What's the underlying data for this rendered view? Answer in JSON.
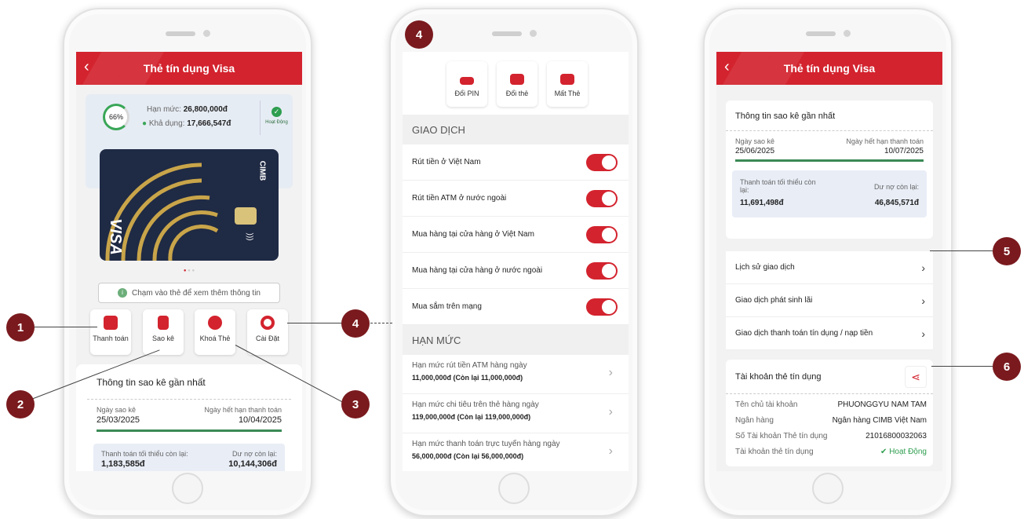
{
  "screen1": {
    "title": "Thẻ tín dụng Visa",
    "progress_pct": "66%",
    "progress_value": 0.66,
    "limit_label": "Hạn mức:",
    "limit_value": "26,800,000đ",
    "available_label": "Khả dụng:",
    "available_value": "17,666,547đ",
    "status": "Hoạt Động",
    "card_brand": "VISA",
    "card_bank": "CIMB",
    "hint": "Chạm vào thẻ để xem thêm thông tin",
    "actions": [
      {
        "label": "Thanh toán",
        "icon": "wallet-icon"
      },
      {
        "label": "Sao kê",
        "icon": "statement-icon"
      },
      {
        "label": "Khoá Thẻ",
        "icon": "lock-icon"
      },
      {
        "label": "Cài Đặt",
        "icon": "gear-icon"
      }
    ],
    "statement": {
      "heading": "Thông tin sao kê gần nhất",
      "date_label": "Ngày sao kê",
      "date_value": "25/03/2025",
      "due_label": "Ngày hết hạn thanh toán",
      "due_value": "10/04/2025",
      "min_label": "Thanh toán tối thiểu còn lại:",
      "min_value": "1,183,585đ",
      "debt_label": "Dư nợ còn lại:",
      "debt_value": "10,144,306đ"
    }
  },
  "screen2": {
    "actions": [
      {
        "label": "Đổi PIN",
        "icon": "pin-icon"
      },
      {
        "label": "Đổi thẻ",
        "icon": "card-change-icon"
      },
      {
        "label": "Mất Thẻ",
        "icon": "lost-card-icon"
      }
    ],
    "transactions_heading": "GIAO DỊCH",
    "transactions": [
      "Rút tiền ở Việt Nam",
      "Rút tiền ATM ở nước ngoài",
      "Mua hàng tại cửa hàng ở Việt Nam",
      "Mua hàng tại cửa hàng ở nước ngoài",
      "Mua sắm trên mạng"
    ],
    "limits_heading": "HẠN MỨC",
    "limits": [
      {
        "label": "Hạn mức rút tiền ATM hàng ngày",
        "value": "11,000,000đ (Còn lại 11,000,000đ)"
      },
      {
        "label": "Hạn mức chi tiêu trên thẻ hàng ngày",
        "value": "119,000,000đ (Còn lại 119,000,000đ)"
      },
      {
        "label": "Hạn mức thanh toán trực tuyến hàng ngày",
        "value": "56,000,000đ (Còn lại 56,000,000đ)"
      }
    ]
  },
  "screen3": {
    "title": "Thẻ tín dụng Visa",
    "statement": {
      "heading": "Thông tin sao kê gần nhất",
      "date_label": "Ngày sao kê",
      "date_value": "25/06/2025",
      "due_label": "Ngày hết hạn thanh toán",
      "due_value": "10/07/2025",
      "min_label": "Thanh toán tối thiểu còn lại:",
      "min_value": "11,691,498đ",
      "debt_label": "Dư nợ còn lại:",
      "debt_value": "46,845,571đ"
    },
    "menu": [
      "Lịch sử giao dịch",
      "Giao dịch phát sinh lãi",
      "Giao dịch thanh toán tín dụng / nạp tiền"
    ],
    "account": {
      "heading": "Tài khoản thẻ tín dụng",
      "holder_label": "Tên chủ tài khoản",
      "holder_value": "PHUONGGYU NAM TAM",
      "bank_label": "Ngân hàng",
      "bank_value": "Ngân hàng CIMB Việt Nam",
      "number_label": "Số Tài khoản Thẻ tín dụng",
      "number_value": "21016800032063",
      "status_label": "Tài khoản thẻ tín dụng",
      "status_value": "Hoạt Động"
    }
  },
  "callouts": [
    "1",
    "2",
    "3",
    "4",
    "4",
    "5",
    "6"
  ],
  "colors": {
    "brand_red": "#d3232e",
    "callout": "#7a1a1e",
    "active_green": "#2e9e4f"
  }
}
